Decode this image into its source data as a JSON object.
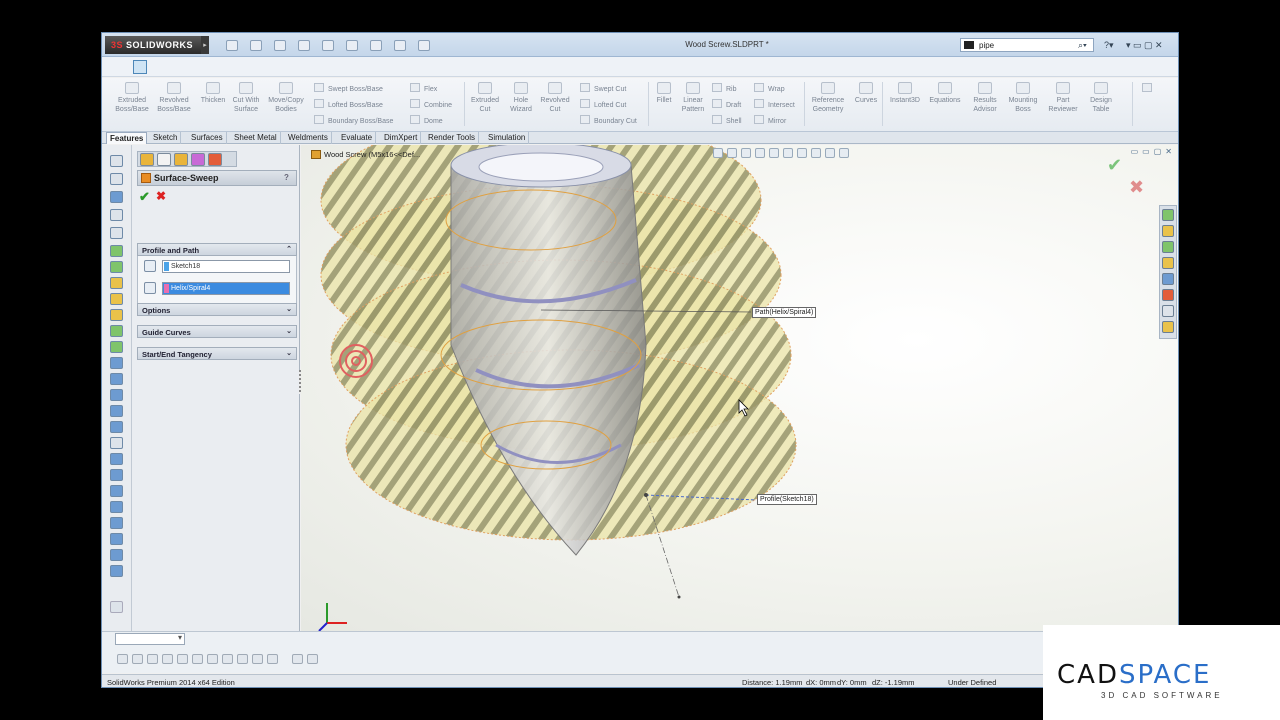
{
  "titlebar": {
    "brand": "SOLIDWORKS",
    "brand_prefix": "3S",
    "document_title": "Wood Screw.SLDPRT *",
    "search_value": "pipe"
  },
  "ribbon": {
    "buttons": [
      {
        "label": "Extruded Boss/Base"
      },
      {
        "label": "Revolved Boss/Base"
      },
      {
        "label": "Thicken"
      },
      {
        "label": "Cut With Surface"
      },
      {
        "label": "Move/Copy Bodies"
      },
      {
        "label": "Extruded Cut"
      },
      {
        "label": "Hole Wizard"
      },
      {
        "label": "Revolved Cut"
      },
      {
        "label": "Fillet"
      },
      {
        "label": "Linear Pattern"
      },
      {
        "label": "Reference Geometry"
      },
      {
        "label": "Curves"
      },
      {
        "label": "Instant3D"
      },
      {
        "label": "Equations"
      },
      {
        "label": "Results Advisor"
      },
      {
        "label": "Mounting Boss"
      },
      {
        "label": "Part Reviewer"
      },
      {
        "label": "Design Table"
      }
    ],
    "small_items": [
      "Swept Boss/Base",
      "Lofted Boss/Base",
      "Boundary Boss/Base",
      "Flex",
      "Combine",
      "Dome",
      "Swept Cut",
      "Lofted Cut",
      "Boundary Cut",
      "Rib",
      "Draft",
      "Shell",
      "Wrap",
      "Intersect",
      "Mirror"
    ]
  },
  "tabs": [
    "Features",
    "Sketch",
    "Surfaces",
    "Sheet Metal",
    "Weldments",
    "Evaluate",
    "DimXpert",
    "Render Tools",
    "Simulation"
  ],
  "property_manager": {
    "title": "Surface-Sweep",
    "help": "?",
    "ok": "✔",
    "cancel": "✖",
    "groups": {
      "profile_path": "Profile and Path",
      "options": "Options",
      "guide_curves": "Guide Curves",
      "tangency": "Start/End Tangency"
    },
    "profile_value": "Sketch18",
    "path_value": "Helix/Spiral4",
    "profile_color": "#4aa3e8",
    "path_color": "#e86fb0"
  },
  "graphics": {
    "tree_path": "Wood Screw  (M5x16<<Def...",
    "callout_path": "Path(Helix/Spiral4)",
    "callout_profile": "Profile(Sketch18)",
    "confirm_ok": "✔",
    "confirm_cancel": "✖"
  },
  "statusbar": {
    "edition": "SolidWorks Premium 2014 x64 Edition",
    "distance": "Distance: 1.19mm",
    "dx": "dX: 0mm",
    "dy": "dY: 0mm",
    "dz": "dZ: -1.19mm",
    "state": "Under Defined"
  },
  "watermark": {
    "brand_a": "CAD",
    "brand_b": "SPACE",
    "tagline": "3D CAD SOFTWARE"
  },
  "colors": {
    "surface_fill": "#ebe4a6",
    "surface_edge": "#e0a060",
    "stripe": "#6a6a45",
    "accent": "#2a6ec8"
  }
}
